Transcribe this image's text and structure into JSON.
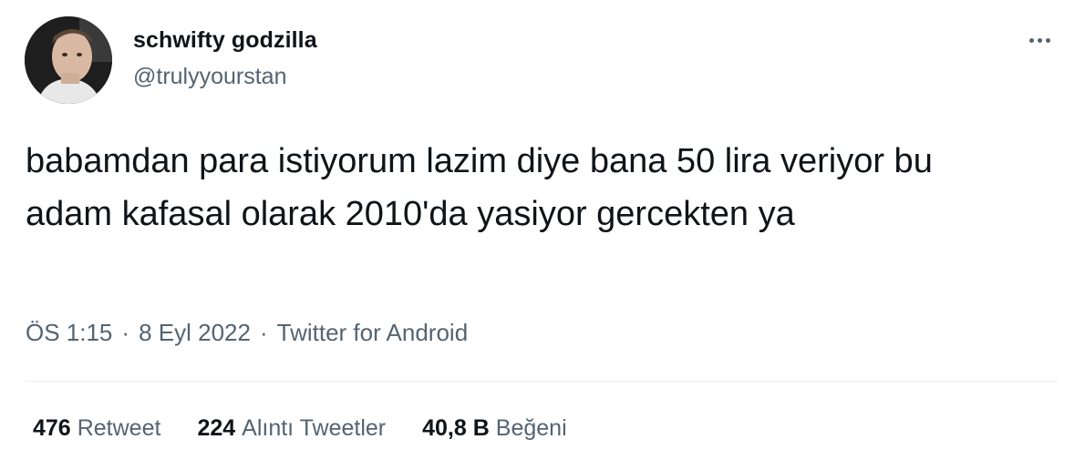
{
  "author": {
    "display_name": "schwifty godzilla",
    "handle": "@trulyyourstan",
    "avatar_icon": "user-avatar"
  },
  "tweet": {
    "text": "babamdan para istiyorum lazim diye bana 50 lira veriyor bu adam kafasal olarak 2010'da yasiyor gercekten ya"
  },
  "meta": {
    "time": "ÖS 1:15",
    "date": "8 Eyl 2022",
    "source": "Twitter for Android",
    "separator": "·"
  },
  "stats": {
    "retweets_count": "476",
    "retweets_label": "Retweet",
    "quotes_count": "224",
    "quotes_label": "Alıntı Tweetler",
    "likes_count": "40,8 B",
    "likes_label": "Beğeni"
  },
  "colors": {
    "text_primary": "#0f1419",
    "text_secondary": "#536471",
    "divider": "#e6ecf0"
  },
  "icons": {
    "more": "more-horizontal-icon"
  }
}
